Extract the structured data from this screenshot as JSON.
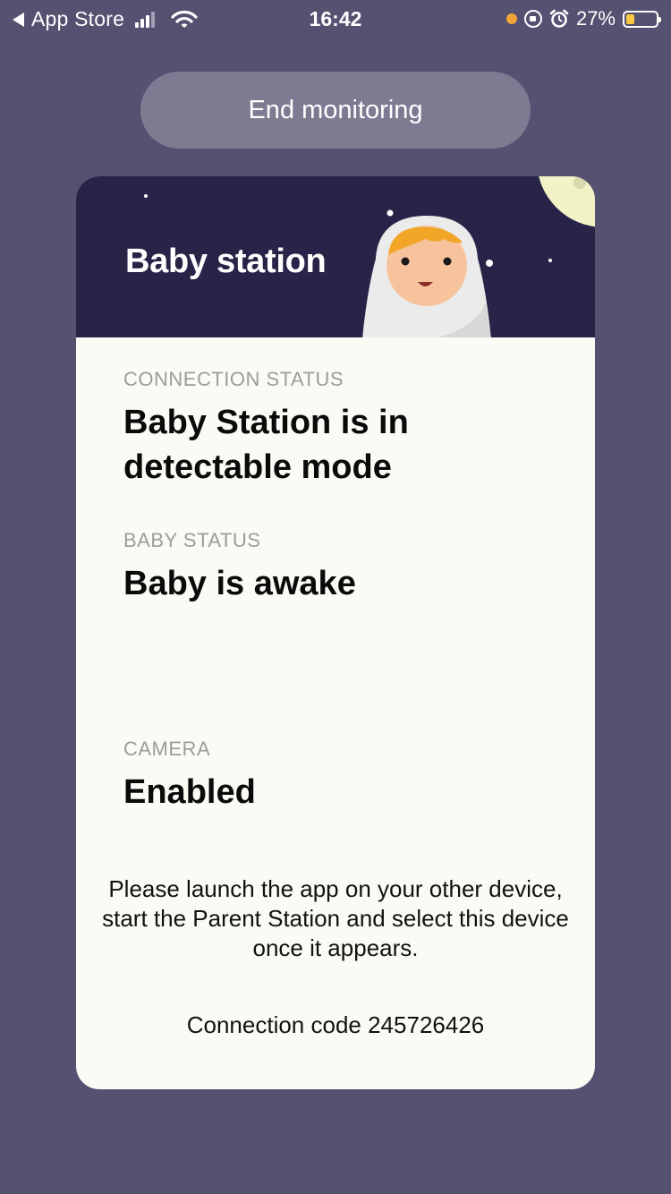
{
  "status_bar": {
    "back_label": "App Store",
    "time": "16:42",
    "battery_percent": "27%",
    "battery_level": 0.27,
    "icons": [
      "back-arrow-icon",
      "signal-icon",
      "wifi-icon",
      "microphone-indicator-icon",
      "rotation-lock-icon",
      "alarm-icon",
      "battery-icon"
    ]
  },
  "end_button": {
    "label": "End monitoring"
  },
  "card": {
    "title": "Baby station",
    "illustration": "baby-avatar-icon",
    "sections": [
      {
        "label": "CONNECTION STATUS",
        "value": "Baby Station is in detectable mode"
      },
      {
        "label": "BABY STATUS",
        "value": "Baby is awake"
      },
      {
        "label": "CAMERA",
        "value": "Enabled"
      }
    ],
    "instructions": "Please launch the app on your other device, start the Parent Station and select this device once it appears.",
    "connection_code": "Connection code 245726426"
  },
  "colors": {
    "background": "#545171",
    "header": "#282448",
    "card": "#fbfbf5",
    "button": "#7c7b92",
    "label": "#9c9c9c"
  }
}
